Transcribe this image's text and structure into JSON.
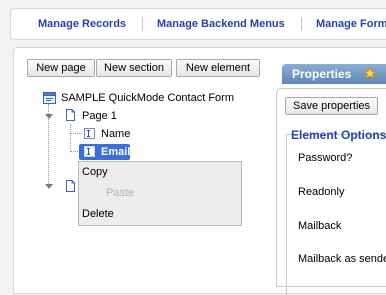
{
  "topnav": {
    "links": [
      "Manage Records",
      "Manage Backend Menus",
      "Manage Form"
    ]
  },
  "toolbar": {
    "new_page": "New page",
    "new_section": "New section",
    "new_element": "New element"
  },
  "tree": {
    "form_label": "SAMPLE QuickMode Contact Form",
    "page_label": "Page 1",
    "elements": [
      "Name",
      "Email"
    ],
    "selected": "Email"
  },
  "context_menu": {
    "copy": "Copy",
    "paste": "Paste",
    "delete": "Delete"
  },
  "properties": {
    "tab_label": "Properties",
    "save_label": "Save properties",
    "section_title": "Element Options",
    "options": [
      "Password?",
      "Readonly",
      "Mailback",
      "Mailback as sender"
    ]
  },
  "colors": {
    "link": "#2146a8",
    "selection": "#3a6fd8",
    "tab": "#6f95c2"
  }
}
